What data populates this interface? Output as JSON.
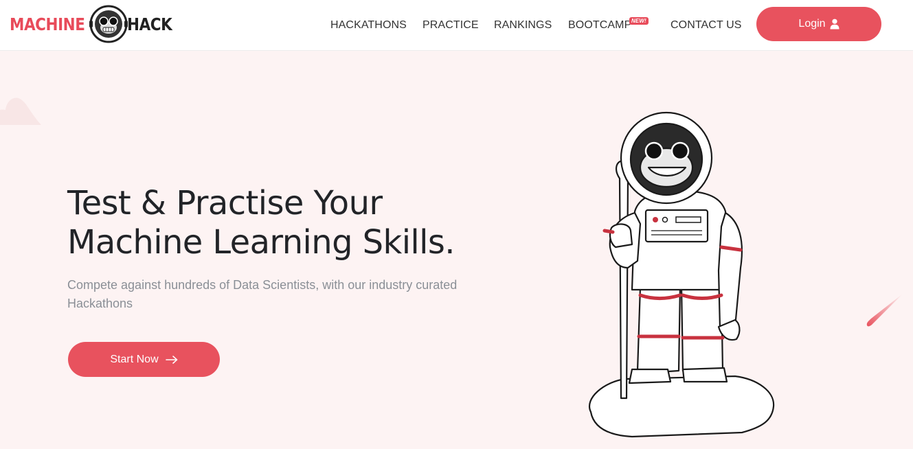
{
  "brand": {
    "part1": "MACHINE",
    "part2": "HACK",
    "accent": "#e84b5a"
  },
  "nav": {
    "items": [
      {
        "label": "HACKATHONS"
      },
      {
        "label": "PRACTICE"
      },
      {
        "label": "RANKINGS"
      },
      {
        "label": "BOOTCAMP",
        "badge": "NEW!"
      },
      {
        "label": "CONTACT US"
      }
    ],
    "login_label": "Login"
  },
  "hero": {
    "title_line1": "Test & Practise Your",
    "title_line2": "Machine Learning Skills.",
    "subtitle": "Compete against hundreds of Data Scientists, with our industry curated Hackathons",
    "cta_label": "Start Now"
  },
  "icons": {
    "user": "user-icon",
    "arrow": "arrow-right-icon",
    "mascot": "astronaut-monkey-mascot"
  },
  "colors": {
    "accent": "#e8525e",
    "hero_bg": "#fdf3f3",
    "text_dark": "#222428",
    "text_muted": "#8a8f96"
  }
}
